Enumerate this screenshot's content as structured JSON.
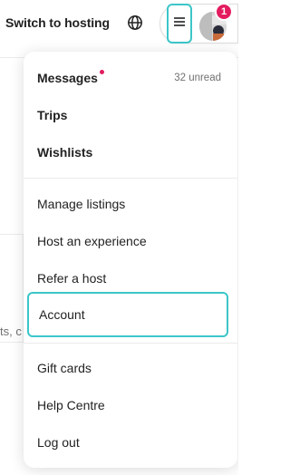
{
  "header": {
    "switch_label": "Switch to hosting",
    "globe_icon": "globe-icon",
    "menu_icon": "hamburger-menu-icon",
    "notification_count": "1"
  },
  "background": {
    "partial_text": "ts, c"
  },
  "menu": {
    "messages": {
      "label": "Messages",
      "status": "32 unread"
    },
    "trips": "Trips",
    "wishlists": "Wishlists",
    "manage_listings": "Manage listings",
    "host_experience": "Host an experience",
    "refer_host": "Refer a host",
    "account": "Account",
    "gift_cards": "Gift cards",
    "help_centre": "Help Centre",
    "log_out": "Log out"
  },
  "colors": {
    "accent_highlight": "#3cc6c9",
    "notification": "#e31c5f",
    "text": "#222222",
    "muted": "#717171"
  }
}
